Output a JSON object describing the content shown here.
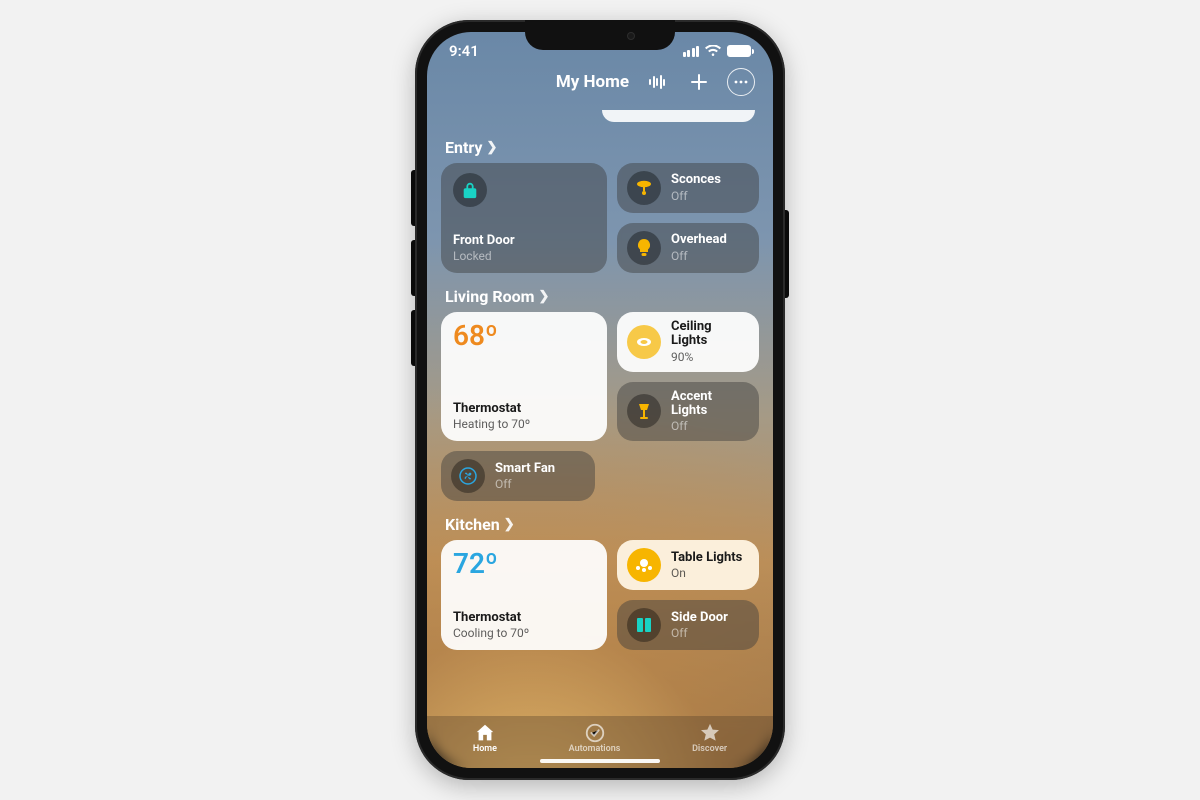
{
  "statusbar": {
    "time": "9:41"
  },
  "header": {
    "title": "My Home"
  },
  "sections": {
    "entry": {
      "title": "Entry",
      "front_door": {
        "name": "Front Door",
        "status": "Locked"
      },
      "sconces": {
        "name": "Sconces",
        "status": "Off"
      },
      "overhead": {
        "name": "Overhead",
        "status": "Off"
      }
    },
    "living_room": {
      "title": "Living Room",
      "thermostat": {
        "temp": "68º",
        "name": "Thermostat",
        "status": "Heating to 70º"
      },
      "ceiling": {
        "name": "Ceiling Lights",
        "status": "90%"
      },
      "accent": {
        "name": "Accent Lights",
        "status": "Off"
      },
      "fan": {
        "name": "Smart Fan",
        "status": "Off"
      }
    },
    "kitchen": {
      "title": "Kitchen",
      "thermostat": {
        "temp": "72º",
        "name": "Thermostat",
        "status": "Cooling to 70º"
      },
      "table": {
        "name": "Table Lights",
        "status": "On"
      },
      "side_door": {
        "name": "Side Door",
        "status": "Off"
      }
    }
  },
  "tabs": {
    "home": "Home",
    "automations": "Automations",
    "discover": "Discover"
  },
  "colors": {
    "heat": "#ee8a1f",
    "cool": "#2aa6e0",
    "lock": "#19d3c5",
    "bulb_amber": "#f7b500"
  }
}
